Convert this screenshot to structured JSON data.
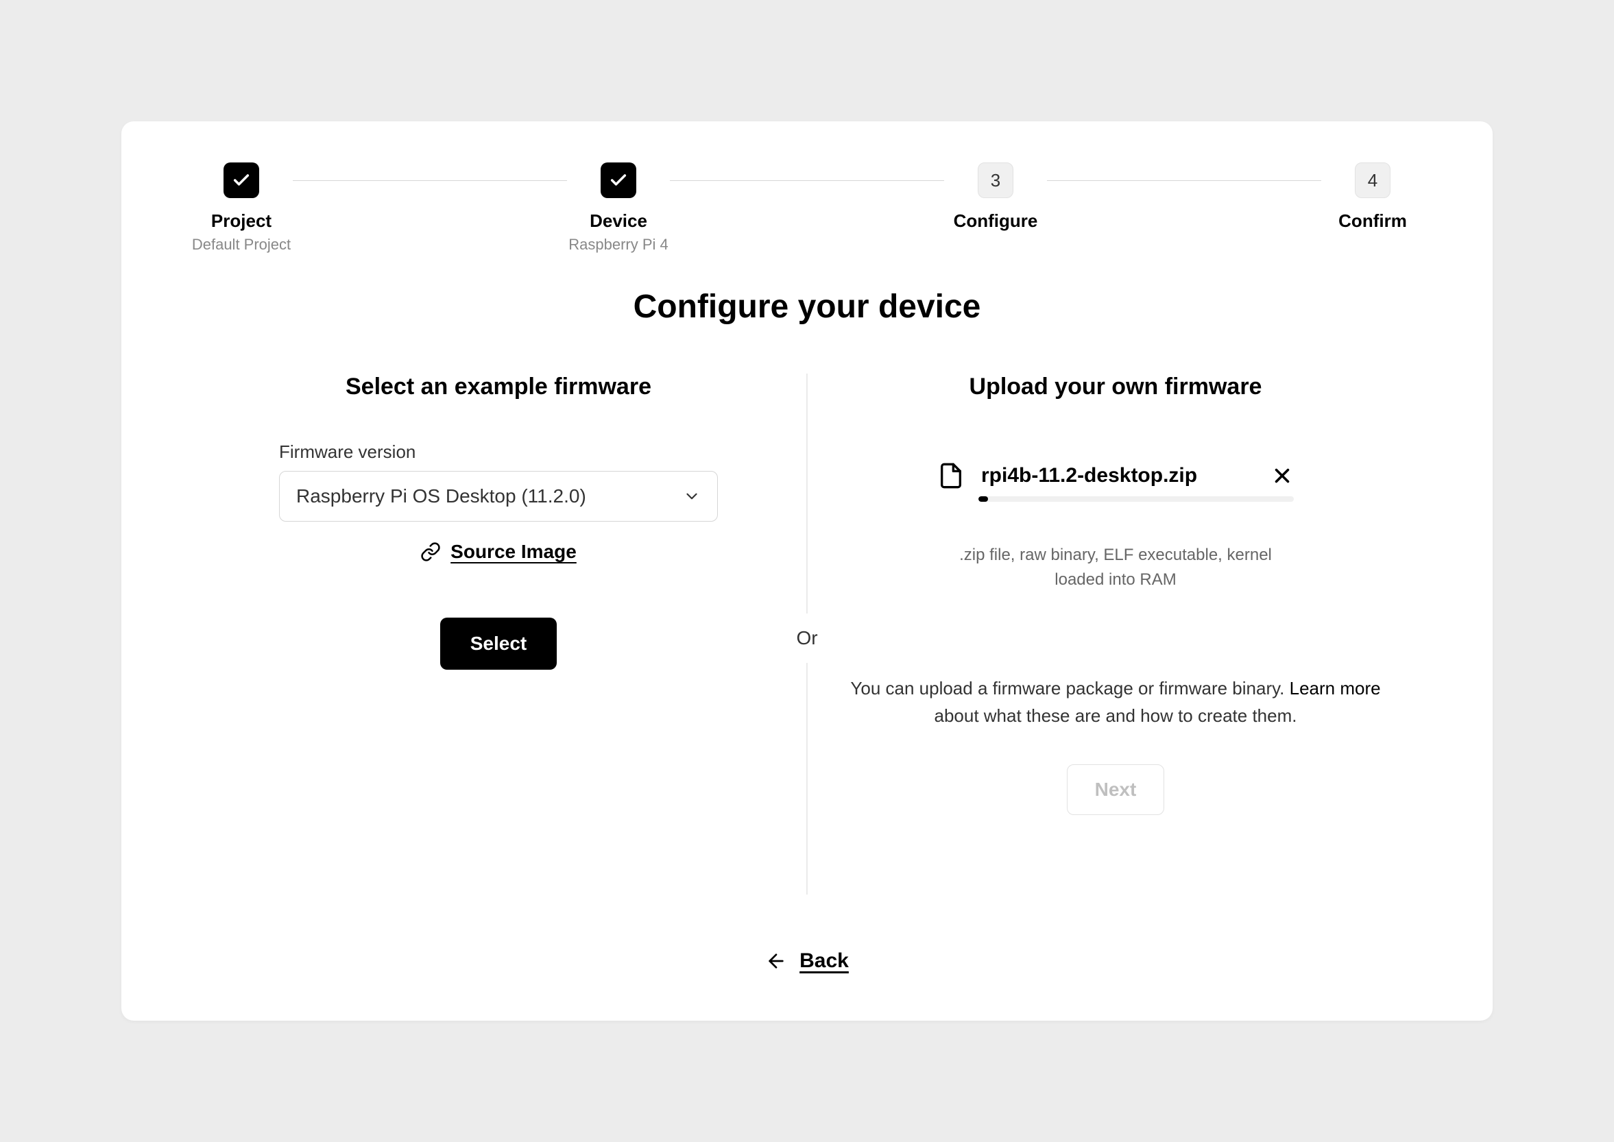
{
  "stepper": {
    "steps": [
      {
        "label": "Project",
        "sub": "Default Project",
        "done": true
      },
      {
        "label": "Device",
        "sub": "Raspberry Pi 4",
        "done": true
      },
      {
        "label": "Configure",
        "num": "3"
      },
      {
        "label": "Confirm",
        "num": "4"
      }
    ]
  },
  "title": "Configure your device",
  "divider_or": "Or",
  "left": {
    "heading": "Select an example firmware",
    "field_label": "Firmware version",
    "selected": "Raspberry Pi OS Desktop (11.2.0)",
    "source_link": "Source Image",
    "button": "Select"
  },
  "right": {
    "heading": "Upload your own firmware",
    "filename": "rpi4b-11.2-desktop.zip",
    "progress_pct": 3,
    "hint": ".zip file, raw binary, ELF executable, kernel loaded into RAM",
    "description_pre": "You can upload a firmware package or firmware binary. ",
    "learn_more": "Learn more",
    "description_post": " about what these are and how to create them.",
    "next": "Next"
  },
  "back": "Back"
}
